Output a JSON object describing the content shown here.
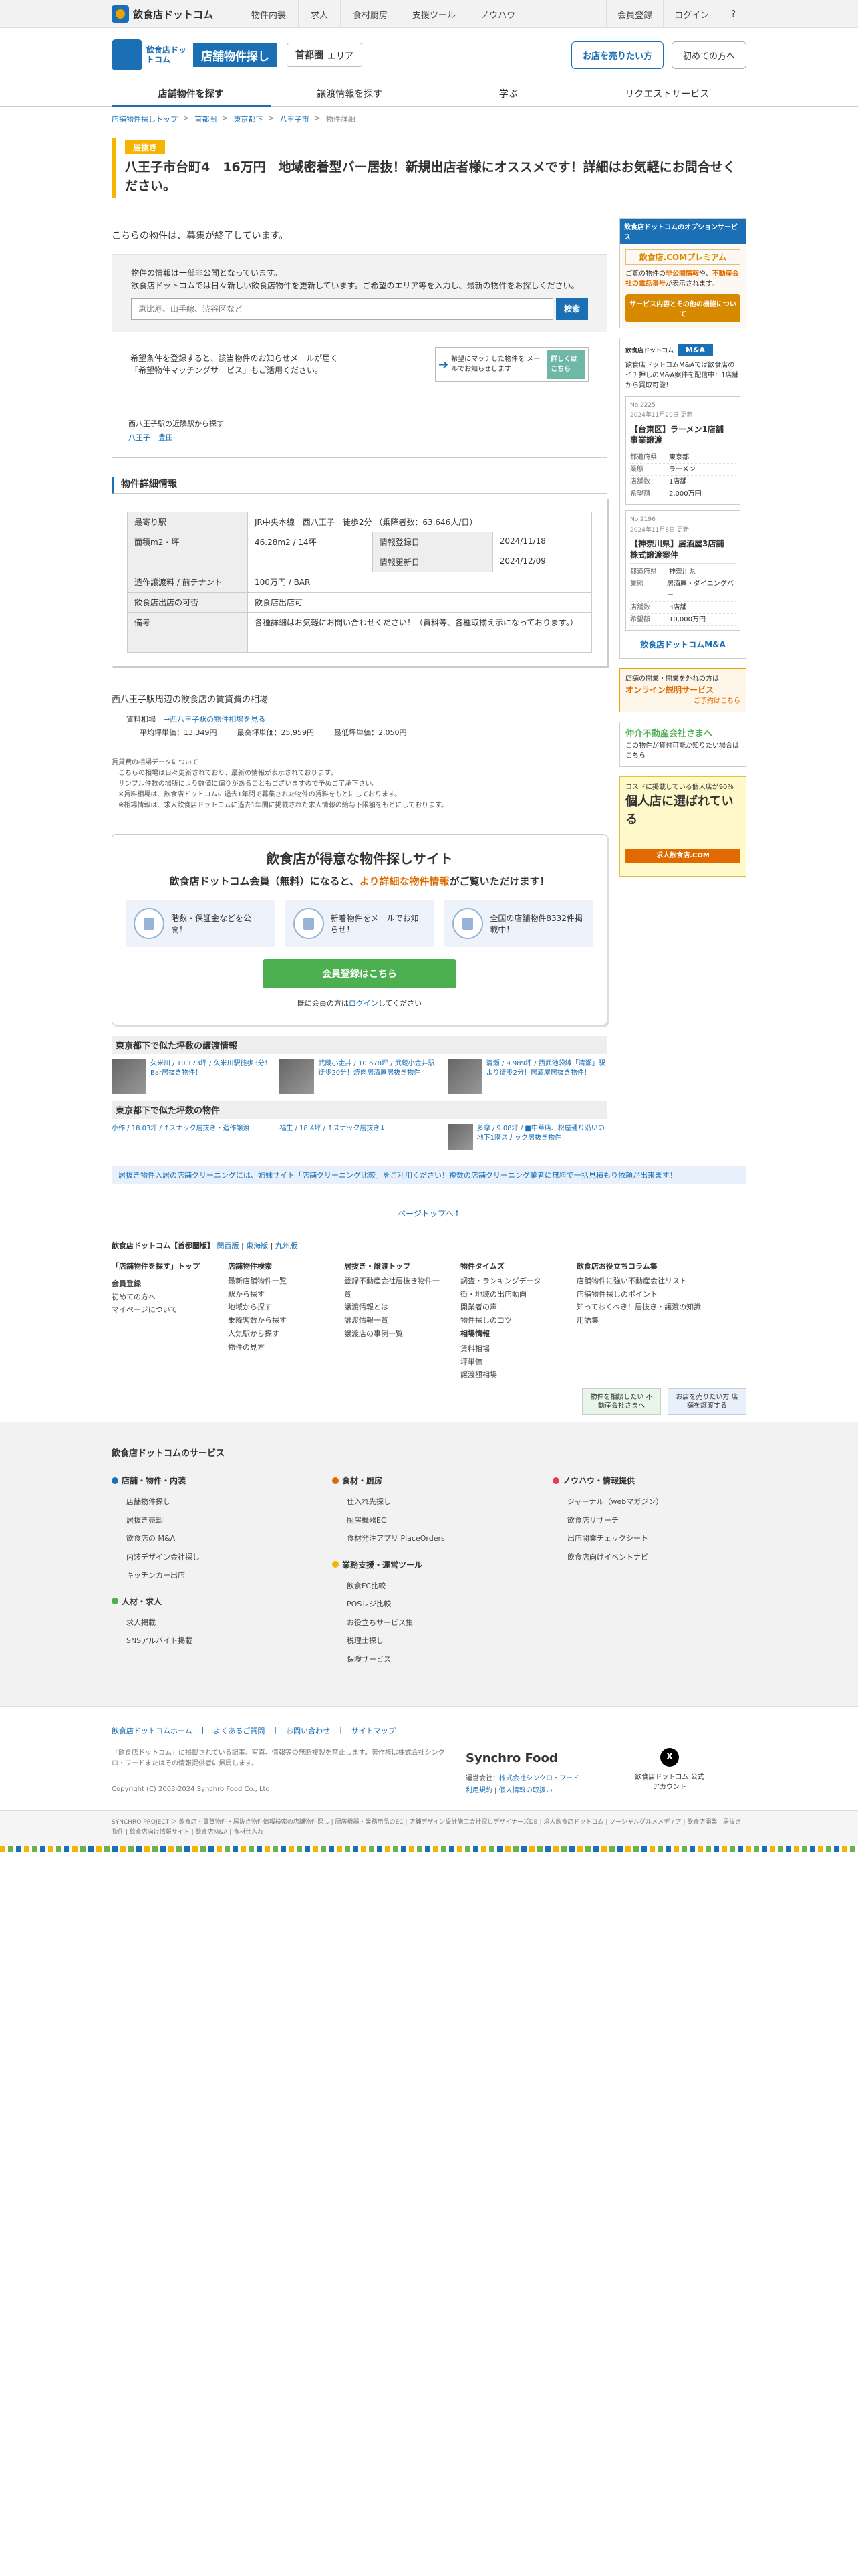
{
  "topbar": {
    "logo": "飲食店ドットコム",
    "nav": [
      "物件内装",
      "求人",
      "食材厨房",
      "支援ツール",
      "ノウハウ"
    ],
    "right": [
      "会員登録",
      "ログイン",
      "?"
    ]
  },
  "header": {
    "logo_text": "飲食店ドットコム",
    "site_name": "店舗物件探し",
    "area": "首都圏",
    "area_suffix": "エリア",
    "btn_sell": "お店を売りたい方",
    "btn_first": "初めての方へ"
  },
  "tabs": [
    "店舗物件を探す",
    "譲渡情報を探す",
    "学ぶ",
    "リクエストサービス"
  ],
  "breadcrumb": [
    "店舗物件探しトップ",
    "首都圏",
    "東京都下",
    "八王子市",
    "物件詳細"
  ],
  "listing": {
    "badge": "居抜き",
    "title": "八王子市台町4　16万円　地域密着型バー居抜！新規出店者様にオススメです！詳細はお気軽にお問合せください。",
    "ended": "こちらの物件は、募集が終了しています。"
  },
  "search": {
    "text1": "物件の情報は一部非公開となっています。",
    "text2": "飲食店ドットコムでは日々新しい飲食店物件を更新しています。ご希望のエリア等を入力し、最新の物件をお探しください。",
    "placeholder": "恵比寿、山手線、渋谷区など",
    "button": "検索"
  },
  "notify": {
    "text1": "希望条件を登録すると、該当物件のお知らせメールが届く",
    "text2": "「希望物件マッチングサービス」もご活用ください。",
    "btn_text": "希望にマッチした物件を メールでお知らせします",
    "btn_badge": "詳しくは こちら"
  },
  "near": {
    "label": "西八王子駅の近隣駅から探す",
    "links": [
      "八王子",
      "豊田"
    ]
  },
  "detail": {
    "heading": "物件詳細情報",
    "rows": [
      {
        "k": "最寄り駅",
        "v": "JR中央本線　西八王子　徒歩2分 （乗降者数：63,646人/日）"
      },
      {
        "k": "面積m2・坪",
        "v": "46.28m2 / 14坪",
        "k2": "情報登録日",
        "v2": "2024/11/18",
        "k3": "情報更新日",
        "v3": "2024/12/09"
      },
      {
        "k": "造作譲渡料 / 前テナント",
        "v": "100万円 / BAR"
      },
      {
        "k": "飲食店出店の可否",
        "v": "飲食店出店可"
      },
      {
        "k": "備考",
        "v": "各種詳細はお気軽にお問い合わせください！（資料等、各種取揃え示になっております。）"
      }
    ]
  },
  "rent": {
    "heading": "西八王子駅周辺の飲食店の賃貸費の相場",
    "label": "賃料相場",
    "link": "→西八王子駅の物件相場を見る",
    "avg": "平均坪単価：13,349円",
    "max": "最高坪単価：25,959円",
    "min": "最低坪単価：2,050円",
    "notes": [
      "賃貸費の相場データについて",
      "こちらの相場は日々更新されており、最新の情報が表示されております。",
      "サンプル件数の場所により数値に偏りがあることもございますので予めご了承下さい。",
      "※賃料相場は、飲食店ドットコムに過去1年間で募集された物件の賃料をもとにしております。",
      "※相場情報は、求人飲食店ドットコムに過去1年間に掲載された求人情報の給与下限額をもとにしております。"
    ]
  },
  "promo": {
    "title": "飲食店が得意な物件探しサイト",
    "sub1": "飲食店ドットコム会員（無料）になると、",
    "sub2": "より詳細な物件情報",
    "sub3": "がご覧いただけます！",
    "feats": [
      "階数・保証金などを公開！",
      "新着物件をメールでお知らせ！",
      "全国の店舗物件8332件掲載中！"
    ],
    "button": "会員登録はこちら",
    "login1": "既に会員の方は",
    "login2": "ログイン",
    "login3": "してください"
  },
  "similar": {
    "h1": "東京都下で似た坪数の譲渡情報",
    "items1": [
      "久米川 / 10.173坪 / 久米川駅徒歩3分！Bar居抜き物件！",
      "武蔵小金井 / 10.678坪 / 武蔵小金井駅徒歩20分！焼肉居酒屋居抜き物件！",
      "清瀬 / 9.989坪 / 西武池袋線「清瀬」駅より徒歩2分！居酒屋居抜き物件！"
    ],
    "h2": "東京都下で似た坪数の物件",
    "items2": [
      "小作 / 18.03坪 / ↑スナック居抜き・造作譲渡",
      "福生 / 18.4坪 / ↑スナック居抜き↓",
      "多摩 / 9.08坪 / ■中華店、松屋通り沿いの地下1階スナック居抜き物件！"
    ]
  },
  "banner_line": "居抜き物件入居の店舗クリーニングには、姉妹サイト「店舗クリーニング比較」をご利用ください！複数の店舗クリーニング業者に無料で一括見積もり依頼が出来ます！",
  "pagetop": "ページトップへ↑",
  "footer_areas": {
    "label": "飲食店ドットコム【首都圏版】",
    "links": [
      "関西版",
      "東海版",
      "九州版"
    ]
  },
  "footer_cols": [
    {
      "h": "「店舗物件を探す」トップ",
      "items": [
        "会員登録",
        "初めての方へ",
        "マイページについて"
      ]
    },
    {
      "h": "店舗物件検索",
      "items": [
        "最新店舗物件一覧",
        "駅から探す",
        "地域から探す",
        "乗降客数から探す",
        "人気駅から探す",
        "物件の見方"
      ]
    },
    {
      "h": "居抜き・譲渡トップ",
      "items": [
        "登録不動産会社居抜き物件一覧",
        "譲渡情報とは",
        "譲渡情報一覧",
        "譲渡店の事例一覧"
      ]
    },
    {
      "h": "物件タイムズ",
      "items": [
        "調査・ランキングデータ",
        "街・地域の出店動向",
        "開業者の声",
        "物件探しのコツ",
        "相場情報",
        "賃料相場",
        "坪単価",
        "譲渡額相場"
      ]
    },
    {
      "h": "飲食店お役立ちコラム集",
      "items": [
        "店舗物件に強い不動産会社リスト",
        "店舗物件探しのポイント",
        "知っておくべき！居抜き・譲渡の知識",
        "用語集"
      ]
    }
  ],
  "footer_banners": [
    "物件を相談したい 不動産会社さまへ",
    "お店を売りたい方 店舗を譲渡する"
  ],
  "services": {
    "title": "飲食店ドットコムのサービス",
    "c1": [
      {
        "h": "店舗・物件・内装",
        "color": "#1a6fb5",
        "items": [
          "店舗物件探し",
          "居抜き売却",
          "飲食店の M&A",
          "内装デザイン会社探し",
          "キッチンカー出店"
        ]
      },
      {
        "h": "人材・求人",
        "color": "#4caf50",
        "items": [
          "求人掲載",
          "SNSアルバイト掲載"
        ]
      }
    ],
    "c2": [
      {
        "h": "食材・厨房",
        "color": "#e06a00",
        "items": [
          "仕入れ先探し",
          "厨房機器EC",
          "食材発注アプリ PlaceOrders"
        ]
      },
      {
        "h": "業務支援・運営ツール",
        "color": "#f5b400",
        "items": [
          "飲食FC比較",
          "POSレジ比較",
          "お役立ちサービス集",
          "税理士探し",
          "保険サービス"
        ]
      }
    ],
    "c3": [
      {
        "h": "ノウハウ・情報提供",
        "color": "#e04050",
        "items": [
          "ジャーナル（webマガジン）",
          "飲食店リサーチ",
          "出店開業チェックシート",
          "飲食店向けイベントナビ"
        ]
      }
    ]
  },
  "ft2": {
    "links": [
      "飲食店ドットコムホーム",
      "よくあるご質問",
      "お問い合わせ",
      "サイトマップ"
    ],
    "legal": "「飲食店ドットコム」に掲載されている記事、写真、情報等の無断複製を禁止します。著作権は株式会社シンクロ・フードまたはその情報提供者に帰属します。",
    "copy": "Copyright (C) 2003-2024 Synchro Food Co., Ltd.",
    "sf_logo": "Synchro Food",
    "sf_op": "運営会社：",
    "sf_co": "株式会社シンクロ・フード",
    "sf_l1": "利用規約",
    "sf_l2": "個人情報の取扱い",
    "x_label": "飲食店ドットコム 公式アカウント",
    "x_icon": "X"
  },
  "project": "SYNCHRO PROJECT ＞ 飲食店・賃貸物件・居抜き物件情報検索の店舗物件探し | 厨房機器・業務用品のEC | 店舗デザイン設計施工会社探しデザイナーズDB | 求人飲食店ドットコム | ソーシャルグルメメディア | 飲食店開業 | 居抜き物件 | 飲食店向け情報サイト | 飲食店M&A | 食材仕入れ",
  "sidebar": {
    "opt_head": "飲食店ドットコムのオプションサービス",
    "prem_title": "飲食店.COMプレミアム",
    "prem_text1": "ご覧の物件の",
    "prem_em1": "非公開情報",
    "prem_text2": "や、",
    "prem_em2": "不動産会社の電話番号",
    "prem_text3": "が表示されます。",
    "prem_btn": "サービス内容とその他の機能について",
    "ma_logo": "飲食店ドットコム",
    "ma_badge": "M&A",
    "ma_text": "飲食店ドットコムM&Aでは飲食店のイチ押しのM&A案件を配信中！1店舗から買取可能！",
    "deals": [
      {
        "no": "No.2225",
        "date": "2024年11月20日 更新",
        "title": "【台東区】ラーメン1店舗　事業譲渡",
        "rows": [
          [
            "都道府県",
            "東京都"
          ],
          [
            "業態",
            "ラーメン"
          ],
          [
            "店舗数",
            "1店舗"
          ],
          [
            "希望額",
            "2,000万円"
          ]
        ]
      },
      {
        "no": "No.2196",
        "date": "2024年11月8日 更新",
        "title": "【神奈川県】居酒屋3店舗　株式譲渡案件",
        "rows": [
          [
            "都道府県",
            "神奈川県"
          ],
          [
            "業態",
            "居酒屋・ダイニングバー"
          ],
          [
            "店舗数",
            "3店舗"
          ],
          [
            "希望額",
            "10,000万円"
          ]
        ]
      }
    ],
    "ma_more": "飲食店ドットコムM&A",
    "b1_title": "オンライン説明サービス",
    "b1_text": "店舗の開業・開業を外れの方は",
    "b1_btn": "ご予約はこちら",
    "b2_title": "仲介不動産会社さまへ",
    "b2_text": "この物件が貸付可能か知りたい場合はこちら",
    "b3_text": "コスドに掲載している個人店が90%",
    "b3_title": "個人店に選ばれている",
    "b3_sub": "求人飲食店.COM"
  }
}
